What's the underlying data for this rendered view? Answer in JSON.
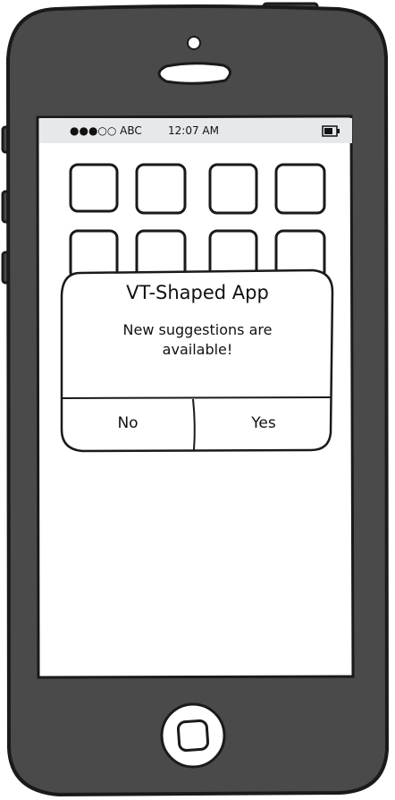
{
  "status_bar": {
    "carrier": "●●●○○ ABC",
    "time": "12:07 AM",
    "battery_icon": "battery-icon"
  },
  "dialog": {
    "title": "VT-Shaped App",
    "message": "New suggestions are available!",
    "no_label": "No",
    "yes_label": "Yes"
  },
  "colors": {
    "phone_body": "#4a4a4a",
    "outline": "#1a1a1a",
    "screen": "#ffffff",
    "status_bar": "#e6e9ec"
  }
}
